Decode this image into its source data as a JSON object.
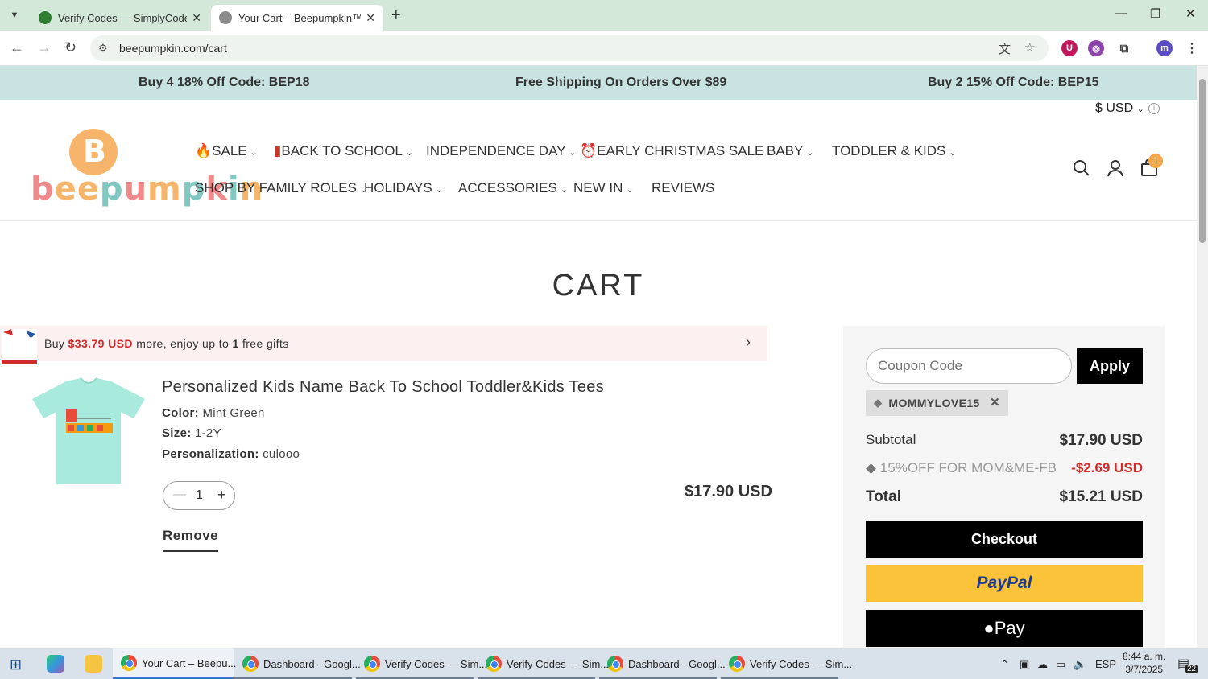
{
  "browser": {
    "tabs": [
      {
        "title": "Verify Codes — SimplyCodes",
        "active": false
      },
      {
        "title": "Your Cart – Beepumpkin™",
        "active": true
      }
    ],
    "url": "beepumpkin.com/cart",
    "profile_initial": "m"
  },
  "promo_bar": {
    "left": "Buy 4 18% Off Code: BEP18",
    "center": "Free Shipping On Orders Over $89",
    "right": "Buy 2 15% Off Code: BEP15"
  },
  "header": {
    "currency": "$ USD",
    "logo_text": "beepumpkin",
    "nav_row1": [
      "SALE",
      "BACK TO SCHOOL",
      "INDEPENDENCE DAY",
      "EARLY CHRISTMAS SALE",
      "BABY",
      "TODDLER & KIDS"
    ],
    "nav_row2": [
      "SHOP BY FAMILY ROLES",
      "HOLIDAYS",
      "ACCESSORIES",
      "NEW IN",
      "REVIEWS"
    ],
    "cart_count": "1"
  },
  "cart": {
    "title": "CART",
    "gift_bar": {
      "prefix": "Buy ",
      "amount": "$33.79 USD",
      "middle": " more, enjoy up to ",
      "count": "1",
      "suffix": " free gifts"
    },
    "item": {
      "name": "Personalized Kids Name Back To School Toddler&Kids Tees",
      "color_label": "Color:",
      "color_value": "Mint Green",
      "size_label": "Size:",
      "size_value": "1-2Y",
      "personalization_label": "Personalization:",
      "personalization_value": "culooo",
      "quantity": "1",
      "price": "$17.90 USD",
      "remove_label": "Remove"
    }
  },
  "summary": {
    "coupon_placeholder": "Coupon Code",
    "apply_label": "Apply",
    "applied_code": "MOMMYLOVE15",
    "subtotal_label": "Subtotal",
    "subtotal_value": "$17.90 USD",
    "discount_label": "15%OFF FOR MOM&ME-FB",
    "discount_value": "-$2.69 USD",
    "total_label": "Total",
    "total_value": "$15.21 USD",
    "checkout_label": "Checkout",
    "paypal_label": "PayPal",
    "applepay_label": " Pay"
  },
  "taskbar": {
    "items": [
      {
        "label": "Your Cart – Beepu...",
        "active": true
      },
      {
        "label": "Dashboard - Googl...",
        "active": false
      },
      {
        "label": "Verify Codes — Sim...",
        "active": false
      },
      {
        "label": "Verify Codes — Sim...",
        "active": false
      },
      {
        "label": "Dashboard - Googl...",
        "active": false
      },
      {
        "label": "Verify Codes — Sim...",
        "active": false
      }
    ],
    "language": "ESP",
    "time": "8:44 a. m.",
    "date": "3/7/2025",
    "notifications": "22"
  },
  "colors": {
    "promo_bg": "#c8e3e2",
    "accent_red": "#d02b2b",
    "paypal_yellow": "#fbc33a",
    "badge_orange": "#f3a64a"
  }
}
